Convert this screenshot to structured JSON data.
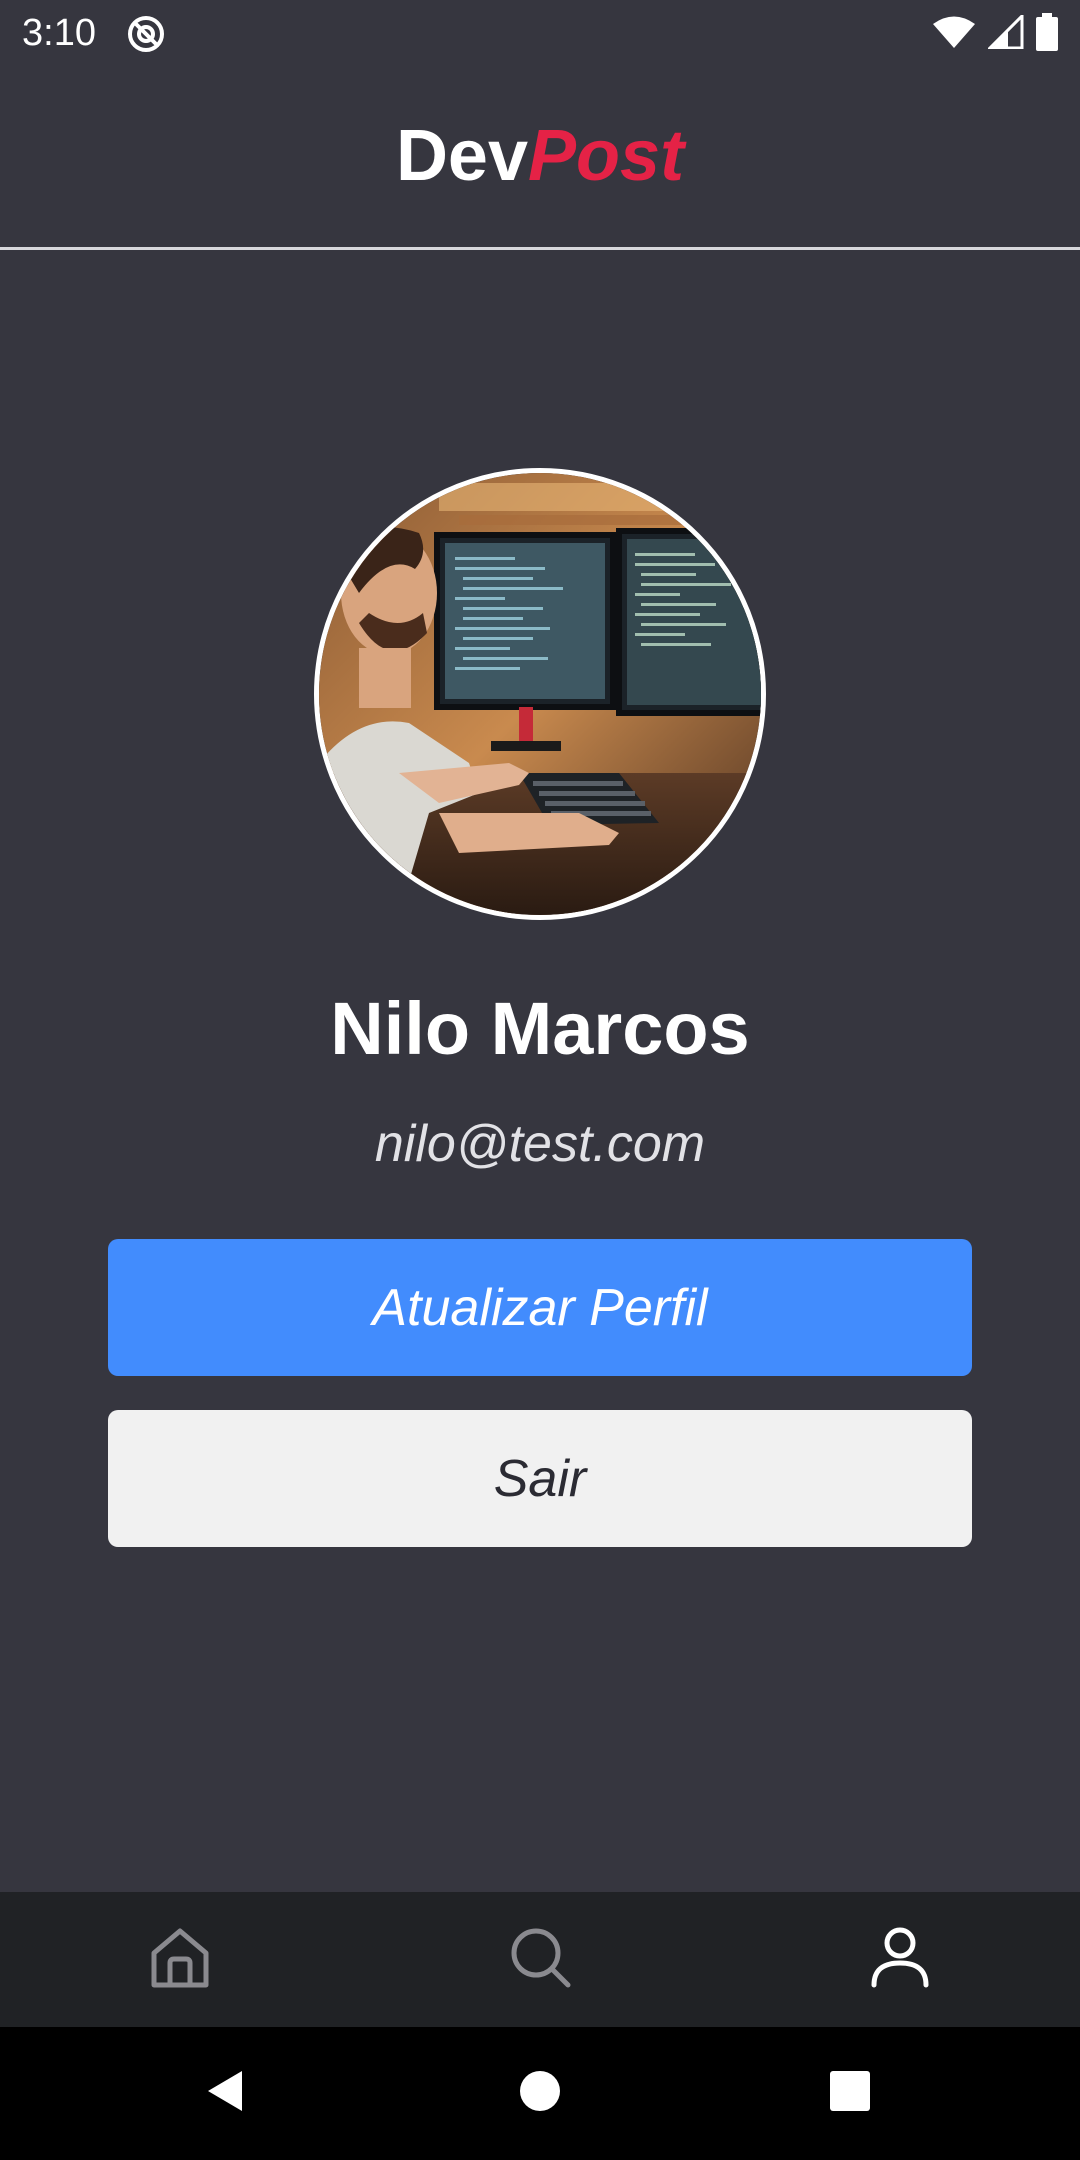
{
  "status_bar": {
    "time": "3:10",
    "icons": [
      "sync-icon",
      "wifi-icon",
      "signal-icon",
      "battery-icon"
    ]
  },
  "header": {
    "brand_part1": "Dev",
    "brand_part2": "Post",
    "brand_accent_color": "#e52246"
  },
  "profile": {
    "avatar_alt": "profile-photo",
    "name": "Nilo Marcos",
    "email": "nilo@test.com"
  },
  "actions": {
    "update_label": "Atualizar Perfil",
    "logout_label": "Sair",
    "update_color": "#428cfd",
    "logout_color": "#f1f1f1"
  },
  "tab_bar": {
    "tabs": [
      {
        "id": "home",
        "icon": "home-icon",
        "active": false
      },
      {
        "id": "search",
        "icon": "search-icon",
        "active": false
      },
      {
        "id": "profile",
        "icon": "user-icon",
        "active": true
      }
    ],
    "active_color": "#ffffff",
    "inactive_color": "#8a8a8f"
  },
  "system_nav": {
    "buttons": [
      "back-icon",
      "home-circle-icon",
      "recents-icon"
    ]
  },
  "colors": {
    "background": "#36363f",
    "tab_bar_background": "#202225"
  }
}
